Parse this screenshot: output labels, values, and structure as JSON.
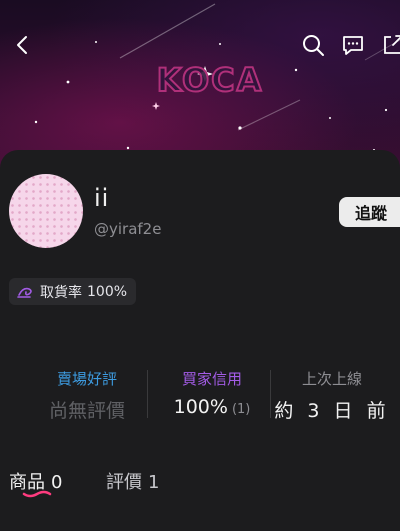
{
  "banner": {
    "logo_text": "KOCA"
  },
  "top_bar": {
    "back_icon": "chevron-left-icon",
    "search_icon": "search-icon",
    "message_icon": "chat-bubble-icon",
    "share_icon": "share-icon"
  },
  "profile": {
    "name": "ii",
    "handle": "@yiraf2e",
    "follow_label": "追蹤",
    "pickup_rate_label": "取貨率",
    "pickup_rate_value": "100%"
  },
  "stats": {
    "seller_rating_title": "賣場好評",
    "seller_rating_value": "尚無評價",
    "buyer_credit_title": "買家信用",
    "buyer_credit_value": "100%",
    "buyer_credit_count": "(1)",
    "last_online_title": "上次上線",
    "last_online_value": "約 3 日 前"
  },
  "tabs": [
    {
      "label": "商品",
      "count": "0"
    },
    {
      "label": "評價",
      "count": "1"
    }
  ],
  "colors": {
    "seller_rating_accent": "#3d9be0",
    "buyer_credit_accent": "#a35ce6",
    "tab_underline": "#ff3b7f"
  }
}
